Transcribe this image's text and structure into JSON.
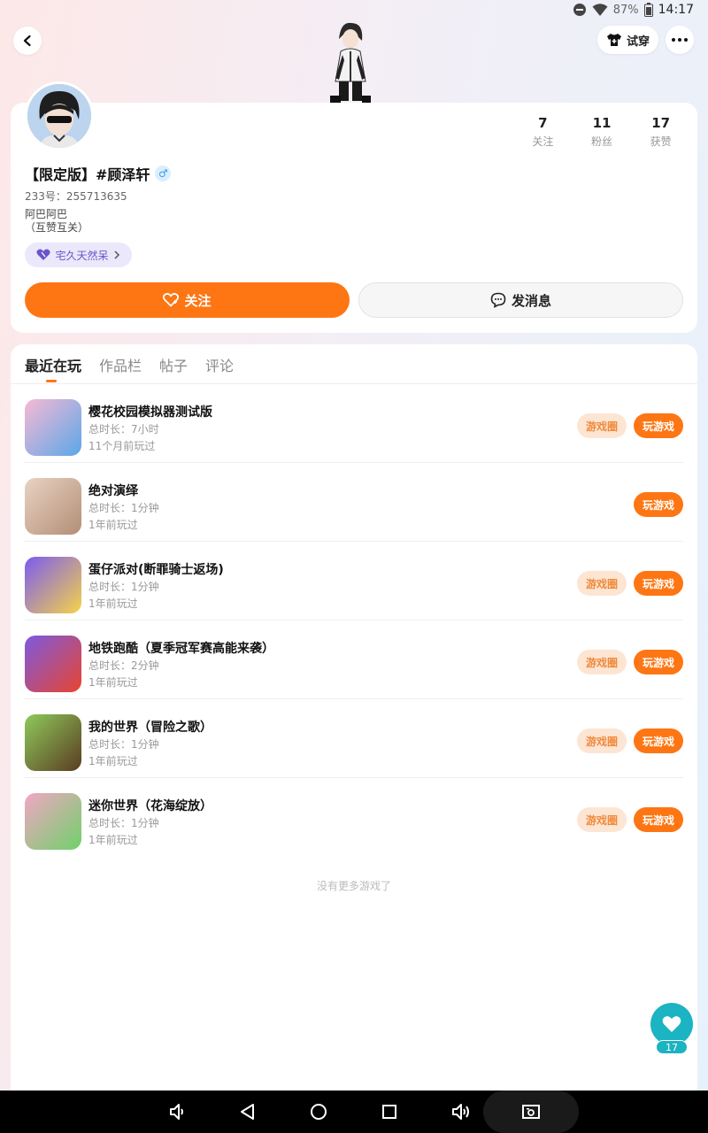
{
  "status_bar": {
    "battery_pct": "87%",
    "time": "14:17"
  },
  "header": {
    "try_on_label": "试穿"
  },
  "profile": {
    "name": "【限定版】#顾泽轩",
    "gender_symbol": "♂",
    "uid": "233号：255713635",
    "bio_line1": "阿巴阿巴",
    "bio_line2": "（互赞互关）",
    "tag": "宅久天然呆",
    "stats": [
      {
        "value": "7",
        "label": "关注"
      },
      {
        "value": "11",
        "label": "粉丝"
      },
      {
        "value": "17",
        "label": "获赞"
      }
    ],
    "follow_label": "关注",
    "message_label": "发消息"
  },
  "tabs": [
    "最近在玩",
    "作品栏",
    "帖子",
    "评论"
  ],
  "games": [
    {
      "name": "樱花校园模拟器测试版",
      "duration": "总时长：7小时",
      "last_played": "11个月前玩过",
      "circle_label": "游戏圈",
      "play_label": "玩游戏",
      "colors": [
        "#f7b9d4",
        "#5aa7e8"
      ]
    },
    {
      "name": "绝对演绎",
      "duration": "总时长：1分钟",
      "last_played": "1年前玩过",
      "circle_label": "",
      "play_label": "玩游戏",
      "colors": [
        "#e8d3c2",
        "#b38e77"
      ]
    },
    {
      "name": "蛋仔派对(断罪骑士返场)",
      "duration": "总时长：1分钟",
      "last_played": "1年前玩过",
      "circle_label": "游戏圈",
      "play_label": "玩游戏",
      "colors": [
        "#7b5cf0",
        "#f6d24a"
      ]
    },
    {
      "name": "地铁跑酷（夏季冠军赛高能来袭）",
      "duration": "总时长：2分钟",
      "last_played": "1年前玩过",
      "circle_label": "游戏圈",
      "play_label": "玩游戏",
      "colors": [
        "#7c5ae0",
        "#e8452f"
      ]
    },
    {
      "name": "我的世界（冒险之歌）",
      "duration": "总时长：1分钟",
      "last_played": "1年前玩过",
      "circle_label": "游戏圈",
      "play_label": "玩游戏",
      "colors": [
        "#8fc95a",
        "#5a3c22"
      ]
    },
    {
      "name": "迷你世界（花海绽放）",
      "duration": "总时长：1分钟",
      "last_played": "1年前玩过",
      "circle_label": "游戏圈",
      "play_label": "玩游戏",
      "colors": [
        "#f2a6c4",
        "#6fd16a"
      ]
    }
  ],
  "footer_note": "没有更多游戏了",
  "like": {
    "count": "17"
  },
  "colors": {
    "accent": "#fd7613",
    "teal": "#1cb3c2",
    "tag_purple": "#6c55c9"
  }
}
